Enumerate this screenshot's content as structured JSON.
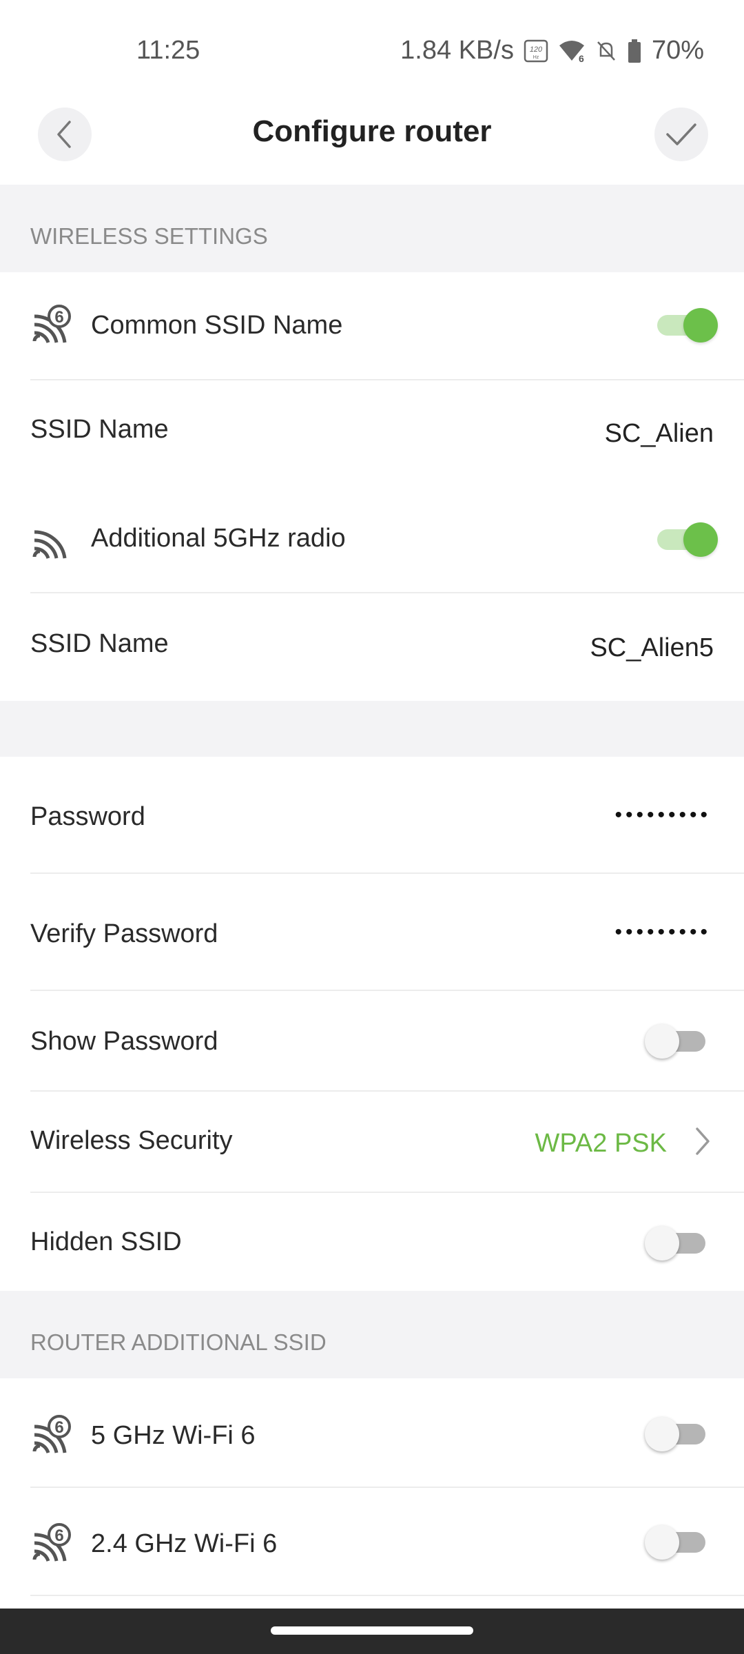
{
  "status_bar": {
    "time": "11:25",
    "speed": "1.84 KB/s",
    "battery": "70%",
    "icons": [
      "120hz-icon",
      "wifi6-icon",
      "no-notifications-icon",
      "battery-icon"
    ]
  },
  "header": {
    "title": "Configure router",
    "back_icon": "chevron-left-icon",
    "confirm_icon": "checkmark-icon"
  },
  "wireless_settings": {
    "section_title": "WIRELESS SETTINGS",
    "common_ssid": {
      "label": "Common SSID Name",
      "icon": "wifi6-icon",
      "enabled": true
    },
    "ssid_name_1": {
      "label": "SSID Name",
      "value": "SC_Alien"
    },
    "additional_radio": {
      "label": "Additional 5GHz radio",
      "icon": "wifi-icon",
      "enabled": true
    },
    "ssid_name_2": {
      "label": "SSID Name",
      "value": "SC_Alien5"
    }
  },
  "security": {
    "password": {
      "label": "Password",
      "value": "•••••••••"
    },
    "verify_password": {
      "label": "Verify Password",
      "value": "•••••••••"
    },
    "show_password": {
      "label": "Show Password",
      "enabled": false
    },
    "wireless_security": {
      "label": "Wireless Security",
      "value": "WPA2 PSK"
    },
    "hidden_ssid": {
      "label": "Hidden SSID",
      "enabled": false
    }
  },
  "additional_ssid": {
    "section_title": "ROUTER ADDITIONAL SSID",
    "items": [
      {
        "label": "5 GHz Wi-Fi 6",
        "icon": "wifi6-icon",
        "enabled": false
      },
      {
        "label": "2.4 GHz Wi-Fi 6",
        "icon": "wifi6-icon",
        "enabled": false
      }
    ]
  },
  "colors": {
    "accent": "#6cc04a",
    "accent_text": "#6cb945",
    "section_bg": "#f3f3f5",
    "section_text": "#8a8a8a"
  }
}
